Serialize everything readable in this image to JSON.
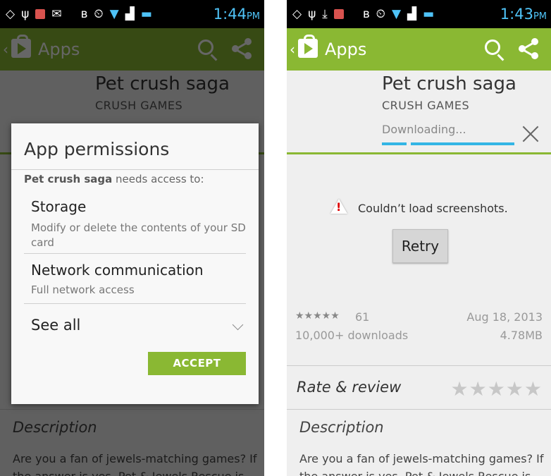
{
  "statusbar_left": {
    "time": "1:44",
    "ampm": "PM"
  },
  "statusbar_right": {
    "time": "1:43",
    "ampm": "PM"
  },
  "appbar": {
    "back": "‹",
    "title": "Apps"
  },
  "app": {
    "title": "Pet crush saga",
    "developer": "CRUSH GAMES"
  },
  "dialog": {
    "title": "App permissions",
    "intro_app": "Pet crush saga",
    "intro_rest": " needs access to:",
    "permissions": [
      {
        "title": "Storage",
        "desc": "Modify or delete the contents of your SD card"
      },
      {
        "title": "Network communication",
        "desc": "Full network access"
      }
    ],
    "see_all": "See all",
    "accept": "ACCEPT"
  },
  "download": {
    "status": "Downloading..."
  },
  "screenshots": {
    "error": "Couldn’t load screenshots.",
    "retry": "Retry"
  },
  "meta": {
    "stars": "★★★★★",
    "rating_count": "61",
    "date": "Aug 18, 2013",
    "downloads": "10,000+ downloads",
    "size": "4.78MB"
  },
  "rate": {
    "label": "Rate & review",
    "stars": "★★★★★"
  },
  "description": {
    "heading": "Description",
    "body": "Are you a fan of jewels-matching games? If the answer is yes, Pet & Jewels Rescue is"
  },
  "colors": {
    "accent": "#8ab833",
    "progress": "#33b5e5",
    "status_time": "#4fc3f7"
  }
}
